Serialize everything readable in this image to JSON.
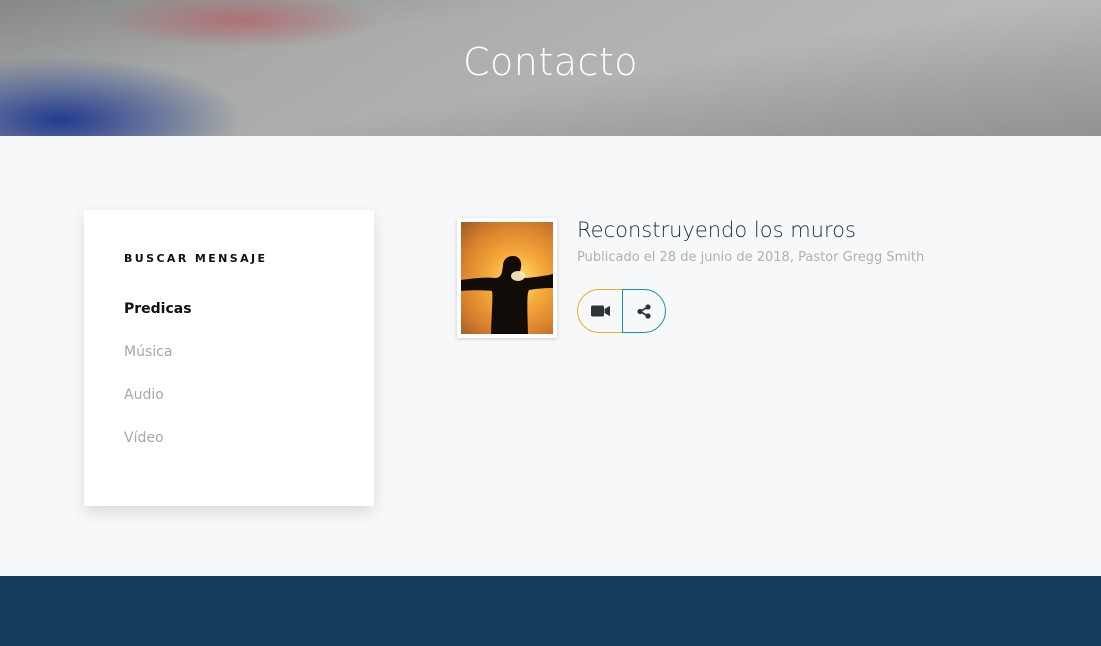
{
  "hero": {
    "title": "Contacto"
  },
  "sidebar": {
    "heading": "BUSCAR MENSAJE",
    "items": [
      {
        "label": "Predicas",
        "active": true
      },
      {
        "label": "Música",
        "active": false
      },
      {
        "label": "Audio",
        "active": false
      },
      {
        "label": "Vídeo",
        "active": false
      }
    ]
  },
  "post": {
    "title": "Reconstruyendo los muros",
    "meta": "Publicado el 28 de junio de 2018, Pastor Gregg Smith",
    "actions": [
      {
        "icon": "video-camera-icon",
        "color": "#e3b424"
      },
      {
        "icon": "share-icon",
        "color": "#1a8fa8"
      }
    ]
  },
  "colors": {
    "footer": "#133b5c",
    "title": "#1c2e42",
    "accent_yellow": "#e3b424",
    "accent_teal": "#1a8fa8"
  }
}
